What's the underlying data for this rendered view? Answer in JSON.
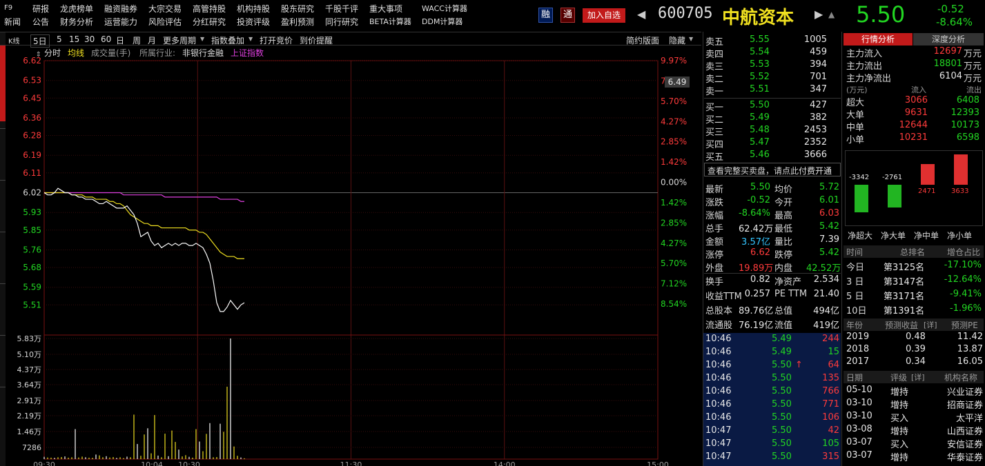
{
  "menu": {
    "f9": "F9",
    "row1": [
      "研报",
      "龙虎榜单",
      "融资融券",
      "大宗交易",
      "高管持股",
      "机构持股",
      "股东研究",
      "千股千评",
      "重大事项",
      "WACC计算器"
    ],
    "row2": [
      "新闻",
      "公告",
      "财务分析",
      "运营能力",
      "风险评估",
      "分红研究",
      "投资评级",
      "盈利预测",
      "同行研究",
      "BETA计算器",
      "DDM计算器"
    ]
  },
  "header": {
    "rong": "融",
    "tong": "通",
    "add": "加入自选",
    "code": "600705",
    "name": "中航资本",
    "price": "5.50",
    "change": "-0.52",
    "change_pct": "-8.64%"
  },
  "toolbar": {
    "items": [
      "K线",
      "5日",
      "5",
      "15",
      "30",
      "60",
      "日",
      "周",
      "月",
      "更多周期",
      "指数叠加",
      "打开竞价",
      "到价提醒"
    ],
    "simple": "简约版面",
    "hide": "隐藏"
  },
  "legend": {
    "fenshi": "分时",
    "junxian": "均线",
    "vol": "成交量(手)",
    "industry_label": "所属行业:",
    "industry": "非银行金融",
    "index": "上证指数"
  },
  "chart_data": {
    "type": "line",
    "y_ticks": [
      "6.62",
      "6.53",
      "6.45",
      "6.36",
      "6.28",
      "6.19",
      "6.11",
      "6.02",
      "5.93",
      "5.85",
      "5.76",
      "5.68",
      "5.59",
      "5.51"
    ],
    "pct_ticks": [
      "9.97%",
      "7.12%",
      "5.70%",
      "4.27%",
      "2.85%",
      "1.42%",
      "0.00%",
      "1.42%",
      "2.85%",
      "4.27%",
      "5.70%",
      "7.12%",
      "8.54%"
    ],
    "vol_ticks": [
      "5.83万",
      "5.10万",
      "4.37万",
      "3.64万",
      "2.91万",
      "2.19万",
      "1.46万",
      "7286"
    ],
    "x_ticks": [
      "09:30",
      "10:04",
      "10:30",
      "11:30",
      "14:00",
      "15:00"
    ],
    "cursor_price": "6.49",
    "ylim": [
      5.42,
      6.62
    ],
    "price": [
      6.02,
      6.01,
      6.01,
      6.02,
      6.04,
      6.03,
      6.02,
      6.02,
      6.01,
      6.01,
      6.0,
      6.0,
      5.99,
      5.99,
      5.99,
      5.98,
      5.97,
      5.97,
      5.98,
      5.97,
      5.96,
      5.95,
      5.95,
      5.95,
      5.96,
      5.94,
      5.92,
      5.88,
      5.82,
      5.83,
      5.84,
      5.8,
      5.78,
      5.79,
      5.77,
      5.78,
      5.79,
      5.78,
      5.79,
      5.78,
      5.79,
      5.79,
      5.78,
      5.78,
      5.79,
      5.78,
      5.77,
      5.74,
      5.7,
      5.62,
      5.52,
      5.48,
      5.48,
      5.5,
      5.53,
      5.51,
      5.49,
      5.51,
      5.52
    ],
    "avg": [
      6.02,
      6.02,
      6.02,
      6.02,
      6.02,
      6.02,
      6.02,
      6.02,
      6.01,
      6.01,
      6.01,
      6.01,
      6.0,
      6.0,
      6.0,
      5.99,
      5.99,
      5.99,
      5.99,
      5.98,
      5.98,
      5.97,
      5.97,
      5.96,
      5.94,
      5.92,
      5.91,
      5.9,
      5.89,
      5.88,
      5.88,
      5.87,
      5.87,
      5.87,
      5.86,
      5.86,
      5.86,
      5.86,
      5.86,
      5.86,
      5.86,
      5.86,
      5.85,
      5.85,
      5.85,
      5.84,
      5.84,
      5.83,
      5.81,
      5.79,
      5.77,
      5.75,
      5.74,
      5.73,
      5.73,
      5.73,
      5.72,
      5.72,
      5.72
    ],
    "index": [
      6.02,
      6.02,
      6.02,
      6.02,
      6.02,
      6.02,
      6.02,
      6.02,
      6.02,
      6.02,
      6.02,
      6.02,
      6.02,
      6.02,
      6.02,
      6.02,
      6.02,
      6.02,
      6.02,
      6.02,
      6.02,
      6.02,
      6.02,
      6.01,
      6.01,
      6.01,
      6.01,
      6.01,
      6.01,
      6.01,
      6.01,
      6.01,
      6.01,
      6.01,
      6.01,
      6.0,
      6.0,
      6.0,
      6.0,
      6.0,
      6.0,
      6.0,
      6.0,
      6.0,
      6.0,
      6.0,
      6.0,
      6.0,
      6.0,
      6.0,
      6.0,
      5.99,
      5.99,
      5.99,
      5.99,
      5.99,
      5.99,
      5.98,
      5.98
    ],
    "volume": [
      1100,
      800,
      700,
      600,
      900,
      1000,
      1300,
      700,
      900,
      14500,
      800,
      1200,
      900,
      700,
      600,
      2200,
      1800,
      900,
      1400,
      800,
      1000,
      600,
      900,
      500,
      1200,
      900,
      21500,
      7300,
      1600,
      11900,
      14900,
      2800,
      21300,
      1700,
      900,
      12300,
      1400,
      13800,
      8300,
      4600,
      1300,
      1900,
      1100,
      700,
      14500,
      8500,
      3800,
      12200,
      17400,
      900,
      1000,
      17100,
      13200,
      35000,
      58300,
      6100,
      1600,
      800,
      400
    ],
    "vmax": 58300
  },
  "orderbook": {
    "asks": [
      {
        "l": "卖五",
        "p": "5.55",
        "v": "1005"
      },
      {
        "l": "卖四",
        "p": "5.54",
        "v": "459"
      },
      {
        "l": "卖三",
        "p": "5.53",
        "v": "394"
      },
      {
        "l": "卖二",
        "p": "5.52",
        "v": "701"
      },
      {
        "l": "卖一",
        "p": "5.51",
        "v": "347"
      }
    ],
    "bids": [
      {
        "l": "买一",
        "p": "5.50",
        "v": "427"
      },
      {
        "l": "买二",
        "p": "5.49",
        "v": "382"
      },
      {
        "l": "买三",
        "p": "5.48",
        "v": "2453"
      },
      {
        "l": "买四",
        "p": "5.47",
        "v": "2352"
      },
      {
        "l": "买五",
        "p": "5.46",
        "v": "3666"
      }
    ],
    "full_text": "查看完整买卖盘，请点此",
    "pay": "付费开通"
  },
  "stats": [
    [
      "最新",
      "5.50",
      "均价",
      "5.72"
    ],
    [
      "涨跌",
      "-0.52",
      "今开",
      "6.01"
    ],
    [
      "涨幅",
      "-8.64%",
      "最高",
      "6.03"
    ],
    [
      "总手",
      "62.42万",
      "最低",
      "5.42"
    ],
    [
      "金额",
      "3.57亿",
      "量比",
      "7.39"
    ],
    [
      "涨停",
      "6.62",
      "跌停",
      "5.42"
    ],
    [
      "外盘",
      "19.89万",
      "内盘",
      "42.52万"
    ]
  ],
  "fin": [
    [
      "换手",
      "0.82",
      "净资产",
      "2.534"
    ],
    [
      "收益TTM",
      "0.257",
      "PE TTM",
      "21.40"
    ],
    [
      "总股本",
      "89.76亿",
      "总值",
      "494亿"
    ],
    [
      "流通股",
      "76.19亿",
      "流值",
      "419亿"
    ]
  ],
  "ticks": [
    {
      "t": "10:46",
      "p": "5.49",
      "v": "244",
      "vc": "r"
    },
    {
      "t": "10:46",
      "p": "5.49",
      "v": "15",
      "vc": "g"
    },
    {
      "t": "10:46",
      "p": "5.50",
      "a": "↑",
      "v": "64",
      "vc": "r"
    },
    {
      "t": "10:46",
      "p": "5.50",
      "v": "135",
      "vc": "r"
    },
    {
      "t": "10:46",
      "p": "5.50",
      "v": "766",
      "vc": "r"
    },
    {
      "t": "10:46",
      "p": "5.50",
      "v": "771",
      "vc": "r"
    },
    {
      "t": "10:46",
      "p": "5.50",
      "v": "106",
      "vc": "r"
    },
    {
      "t": "10:47",
      "p": "5.50",
      "v": "42",
      "vc": "r"
    },
    {
      "t": "10:47",
      "p": "5.50",
      "v": "105",
      "vc": "g"
    },
    {
      "t": "10:47",
      "p": "5.50",
      "v": "315",
      "vc": "r"
    }
  ],
  "analysis": {
    "tab1": "行情分析",
    "tab2": "深度分析",
    "flows": [
      [
        "主力流入",
        "12697",
        "万元"
      ],
      [
        "主力流出",
        "18801",
        "万元"
      ],
      [
        "主力净流出",
        "6104",
        "万元"
      ]
    ],
    "unit": "(万元)",
    "in_hdr": "流入",
    "out_hdr": "流出",
    "sizes": [
      [
        "超大",
        "3066",
        "6408"
      ],
      [
        "大单",
        "9631",
        "12393"
      ],
      [
        "中单",
        "12644",
        "10173"
      ],
      [
        "小单",
        "10231",
        "6598"
      ]
    ],
    "net": [
      {
        "label": "净超大",
        "value": "-3342",
        "n": -3342
      },
      {
        "label": "净大单",
        "value": "-2761",
        "n": -2761
      },
      {
        "label": "净中单",
        "value": "2471",
        "n": 2471
      },
      {
        "label": "净小单",
        "value": "3633",
        "n": 3633
      }
    ]
  },
  "rank": {
    "hdr": [
      "时间",
      "总排名",
      "增仓占比"
    ],
    "rows": [
      [
        "今日",
        "第3125名",
        "-17.10%"
      ],
      [
        "3 日",
        "第3147名",
        "-12.64%"
      ],
      [
        "5 日",
        "第3171名",
        "-9.41%"
      ],
      [
        "10日",
        "第1391名",
        "-1.96%"
      ]
    ]
  },
  "forecast": {
    "hdr": [
      "年份",
      "预测收益",
      "[详]",
      "预测PE"
    ],
    "rows": [
      [
        "2019",
        "0.48",
        "11.42"
      ],
      [
        "2018",
        "0.39",
        "13.87"
      ],
      [
        "2017",
        "0.34",
        "16.05"
      ]
    ]
  },
  "ratings": {
    "hdr": [
      "日期",
      "评级",
      "[详]",
      "机构名称"
    ],
    "rows": [
      [
        "05-10",
        "增持",
        "兴业证券"
      ],
      [
        "03-10",
        "增持",
        "招商证券"
      ],
      [
        "03-10",
        "买入",
        "太平洋"
      ],
      [
        "03-08",
        "增持",
        "山西证券"
      ],
      [
        "03-07",
        "买入",
        "安信证券"
      ],
      [
        "03-07",
        "增持",
        "华泰证券"
      ]
    ]
  }
}
